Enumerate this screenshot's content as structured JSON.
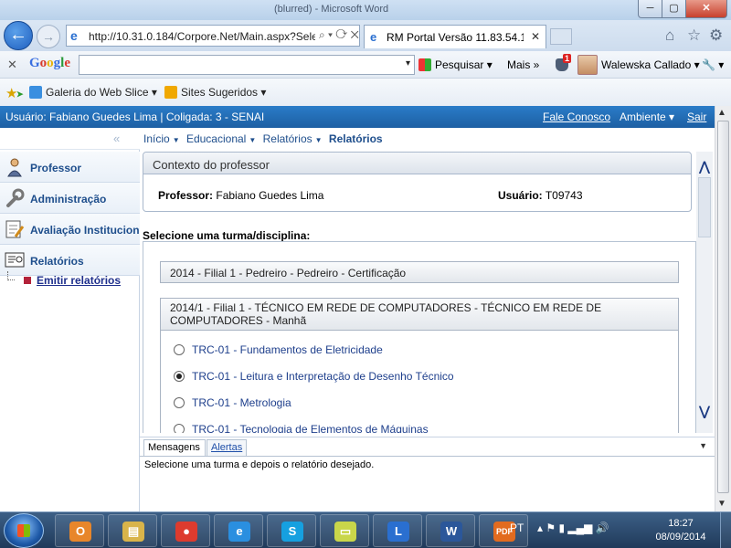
{
  "window": {
    "title": "(blurred) - Microsoft Word",
    "min_glyph": "─",
    "max_glyph": "▢",
    "close_glyph": "✕"
  },
  "browser": {
    "url": "http://10.31.0.184/Corpore.Net/Main.aspx?Sele",
    "url_tools": "⌕ ▾ ⟳ ✕",
    "tab_title": "RM Portal Versão 11.83.54.1...",
    "tab_close": "✕",
    "home_icon": "⌂",
    "star_icon": "☆",
    "gear_icon": "⚙"
  },
  "google_bar": {
    "close": "✕",
    "logo": "Google",
    "search_value": "",
    "search_dropdown": "▾",
    "pesquisar": "Pesquisar ▾",
    "mais": "Mais »",
    "badge": "1",
    "user": "Walewska Callado ▾",
    "tools": "🔧 ▾"
  },
  "favorites_bar": {
    "star": "★",
    "item1": "Galeria do Web Slice ▾",
    "item2": "Sites Sugeridos ▾"
  },
  "app_header": {
    "user_info": "Usuário: Fabiano Guedes Lima  |  Coligada: 3 - SENAI",
    "fale_conosco": "Fale Conosco",
    "ambiente": "Ambiente ▾",
    "sair": "Sair"
  },
  "sidebar": {
    "collapse": "«",
    "items": [
      {
        "label": "Professor"
      },
      {
        "label": "Administração"
      },
      {
        "label": "Avaliação Institucional"
      },
      {
        "label": "Relatórios"
      }
    ],
    "subitem": "Emitir relatórios"
  },
  "breadcrumb": {
    "inicio": "Início",
    "educacional": "Educacional",
    "relatorios": "Relatórios",
    "current": "Relatórios",
    "arrow": "▼"
  },
  "context_box": {
    "title": "Contexto do professor",
    "professor_label": "Professor:",
    "professor_value": "Fabiano Guedes Lima",
    "usuario_label": "Usuário:",
    "usuario_value": "T09743"
  },
  "selection": {
    "heading": "Selecione uma turma/disciplina:",
    "turma1": "2014 - Filial 1 - Pedreiro - Pedreiro - Certificação",
    "turma2": "2014/1 - Filial 1 - TÉCNICO EM REDE DE COMPUTADORES - TÉCNICO EM REDE DE COMPUTADORES - Manhã",
    "disciplinas": [
      {
        "label": "TRC-01 - Fundamentos de Eletricidade",
        "selected": false
      },
      {
        "label": "TRC-01 - Leitura e Interpretação de Desenho Técnico",
        "selected": true
      },
      {
        "label": "TRC-01 - Metrologia",
        "selected": false
      },
      {
        "label": "TRC-01 - Tecnologia de Elementos de Máquinas",
        "selected": false
      }
    ]
  },
  "scroll": {
    "up": "⋀",
    "down": "⋁",
    "bup": "▲",
    "bdown": "▼"
  },
  "messages": {
    "tab_mensagens": "Mensagens",
    "tab_alertas": "Alertas",
    "dropdown": "▼",
    "text": "Selecione uma turma e depois o relatório desejado."
  },
  "taskbar": {
    "lang": "PT",
    "tray_icons": "▴ ⚑ ▮ ▂▄▆ 🔊",
    "time": "18:27",
    "date": "08/09/2014",
    "apps": [
      {
        "name": "outlook",
        "glyph": "O",
        "color": "#e8862a"
      },
      {
        "name": "explorer",
        "glyph": "▤",
        "color": "#d9b44a"
      },
      {
        "name": "chrome",
        "glyph": "●",
        "color": "#dd3b2e"
      },
      {
        "name": "internet-explorer",
        "glyph": "e",
        "color": "#2a8fe0"
      },
      {
        "name": "skype",
        "glyph": "S",
        "color": "#16a0e0"
      },
      {
        "name": "sticky-notes",
        "glyph": "▭",
        "color": "#c9d64a"
      },
      {
        "name": "lync",
        "glyph": "L",
        "color": "#2a6fd0"
      },
      {
        "name": "word",
        "glyph": "W",
        "color": "#2b579a"
      },
      {
        "name": "pdf",
        "glyph": "PDF",
        "color": "#e26b1f"
      }
    ]
  }
}
